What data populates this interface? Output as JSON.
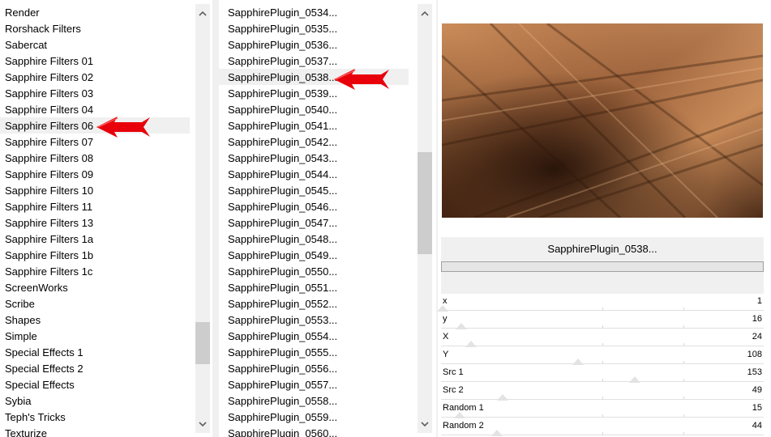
{
  "filter_categories": [
    "Render",
    "Rorshack Filters",
    "Sabercat",
    "Sapphire Filters 01",
    "Sapphire Filters 02",
    "Sapphire Filters 03",
    "Sapphire Filters 04",
    "Sapphire Filters 06",
    "Sapphire Filters 07",
    "Sapphire Filters 08",
    "Sapphire Filters 09",
    "Sapphire Filters 10",
    "Sapphire Filters 11",
    "Sapphire Filters 13",
    "Sapphire Filters 1a",
    "Sapphire Filters 1b",
    "Sapphire Filters 1c",
    "ScreenWorks",
    "Scribe",
    "Shapes",
    "Simple",
    "Special Effects 1",
    "Special Effects 2",
    "Special Effects",
    "Sybia",
    "Teph's Tricks",
    "Texturize"
  ],
  "selected_category": "Sapphire Filters 06",
  "filters": [
    "SapphirePlugin_0534...",
    "SapphirePlugin_0535...",
    "SapphirePlugin_0536...",
    "SapphirePlugin_0537...",
    "SapphirePlugin_0538...",
    "SapphirePlugin_0539...",
    "SapphirePlugin_0540...",
    "SapphirePlugin_0541...",
    "SapphirePlugin_0542...",
    "SapphirePlugin_0543...",
    "SapphirePlugin_0544...",
    "SapphirePlugin_0545...",
    "SapphirePlugin_0546...",
    "SapphirePlugin_0547...",
    "SapphirePlugin_0548...",
    "SapphirePlugin_0549...",
    "SapphirePlugin_0550...",
    "SapphirePlugin_0551...",
    "SapphirePlugin_0552...",
    "SapphirePlugin_0553...",
    "SapphirePlugin_0554...",
    "SapphirePlugin_0555...",
    "SapphirePlugin_0556...",
    "SapphirePlugin_0557...",
    "SapphirePlugin_0558...",
    "SapphirePlugin_0559...",
    "SapphirePlugin_0560..."
  ],
  "selected_filter": "SapphirePlugin_0538...",
  "preview": {
    "preset_name": "SapphirePlugin_0538..."
  },
  "parameters": [
    {
      "label": "x",
      "value": "1"
    },
    {
      "label": "y",
      "value": "16"
    },
    {
      "label": "X",
      "value": "24"
    },
    {
      "label": "Y",
      "value": "108"
    },
    {
      "label": "Src 1",
      "value": "153"
    },
    {
      "label": "Src 2",
      "value": "49"
    },
    {
      "label": "Random 1",
      "value": "15"
    },
    {
      "label": "Random 2",
      "value": "44"
    }
  ],
  "colors": {
    "annotation_arrow": "#e8000a",
    "preview_highlight": "#d2935f",
    "preview_shadow": "#2a1409"
  },
  "icons": {
    "scroll_up": "chevron-up-icon",
    "scroll_down": "chevron-down-icon",
    "annotation": "red-arrow-icon"
  }
}
